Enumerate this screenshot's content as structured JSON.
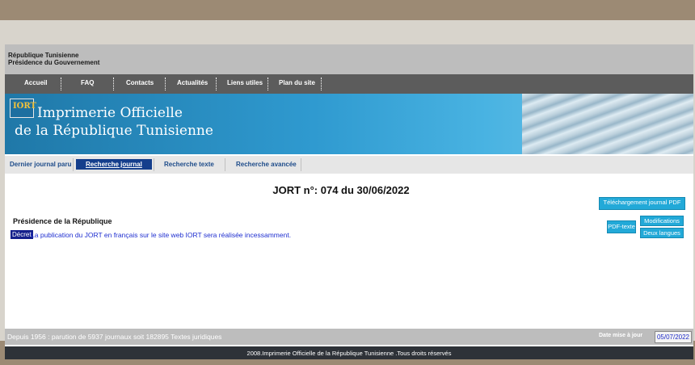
{
  "gov_header": {
    "line1": "République Tunisienne",
    "line2": "Présidence du Gouvernement"
  },
  "top_nav": [
    "Accueil",
    "FAQ",
    "Contacts",
    "Actualités",
    "Liens utiles",
    "Plan du site"
  ],
  "banner": {
    "logo_text": "IORT",
    "title_line1": "Imprimerie Officielle",
    "title_line2": "de la République Tunisienne"
  },
  "tabs": {
    "items": [
      "Dernier journal paru",
      "Recherche journal",
      "Recherche texte",
      "Recherche avancée"
    ],
    "active": "Recherche journal"
  },
  "journal": {
    "title": "JORT n°: 074 du 30/06/2022",
    "download_label": "Téléchargement journal PDF"
  },
  "entry": {
    "section": "Présidence de la République",
    "type": "Décret",
    "description": "La publication du JORT en français sur le site web IORT sera réalisée incessamment.",
    "pdf_label": "PDF-texte",
    "modifications_label": "Modifications",
    "deux_langues_label": "Deux langues"
  },
  "status_bar": {
    "stats": "Depuis 1956 : parution de 5937 journaux soit 182895 Textes juridiques",
    "date_label": "Date mise à jour",
    "date_value": "05/07/2022"
  },
  "footer": {
    "copyright": "2008.Imprimerie Officielle de la République Tunisienne .Tous droits réservés"
  },
  "colors": {
    "nav_bg": "#5c5c5c",
    "banner_blue": "#2f9ad0",
    "active_tab": "#143e8c",
    "button_bg": "#22a9d8",
    "link_text": "#1f2fd0"
  }
}
